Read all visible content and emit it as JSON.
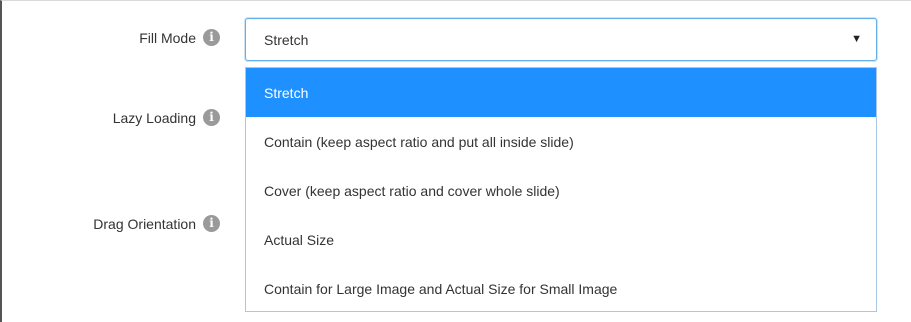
{
  "fields": [
    {
      "label": "Fill Mode",
      "info_icon": "info-icon"
    },
    {
      "label": "Lazy Loading",
      "info_icon": "info-icon"
    },
    {
      "label": "Drag Orientation",
      "info_icon": "info-icon"
    }
  ],
  "fill_mode_select": {
    "value": "Stretch",
    "caret_icon": "caret-down-icon",
    "options": [
      "Stretch",
      "Contain (keep aspect ratio and put all inside slide)",
      "Cover (keep aspect ratio and cover whole slide)",
      "Actual Size",
      "Contain for Large Image and Actual Size for Small Image"
    ],
    "highlighted_index": 0
  },
  "colors": {
    "highlight": "#1e90ff",
    "focus_border": "#66afe9",
    "info_icon": "#9a9a9a"
  }
}
